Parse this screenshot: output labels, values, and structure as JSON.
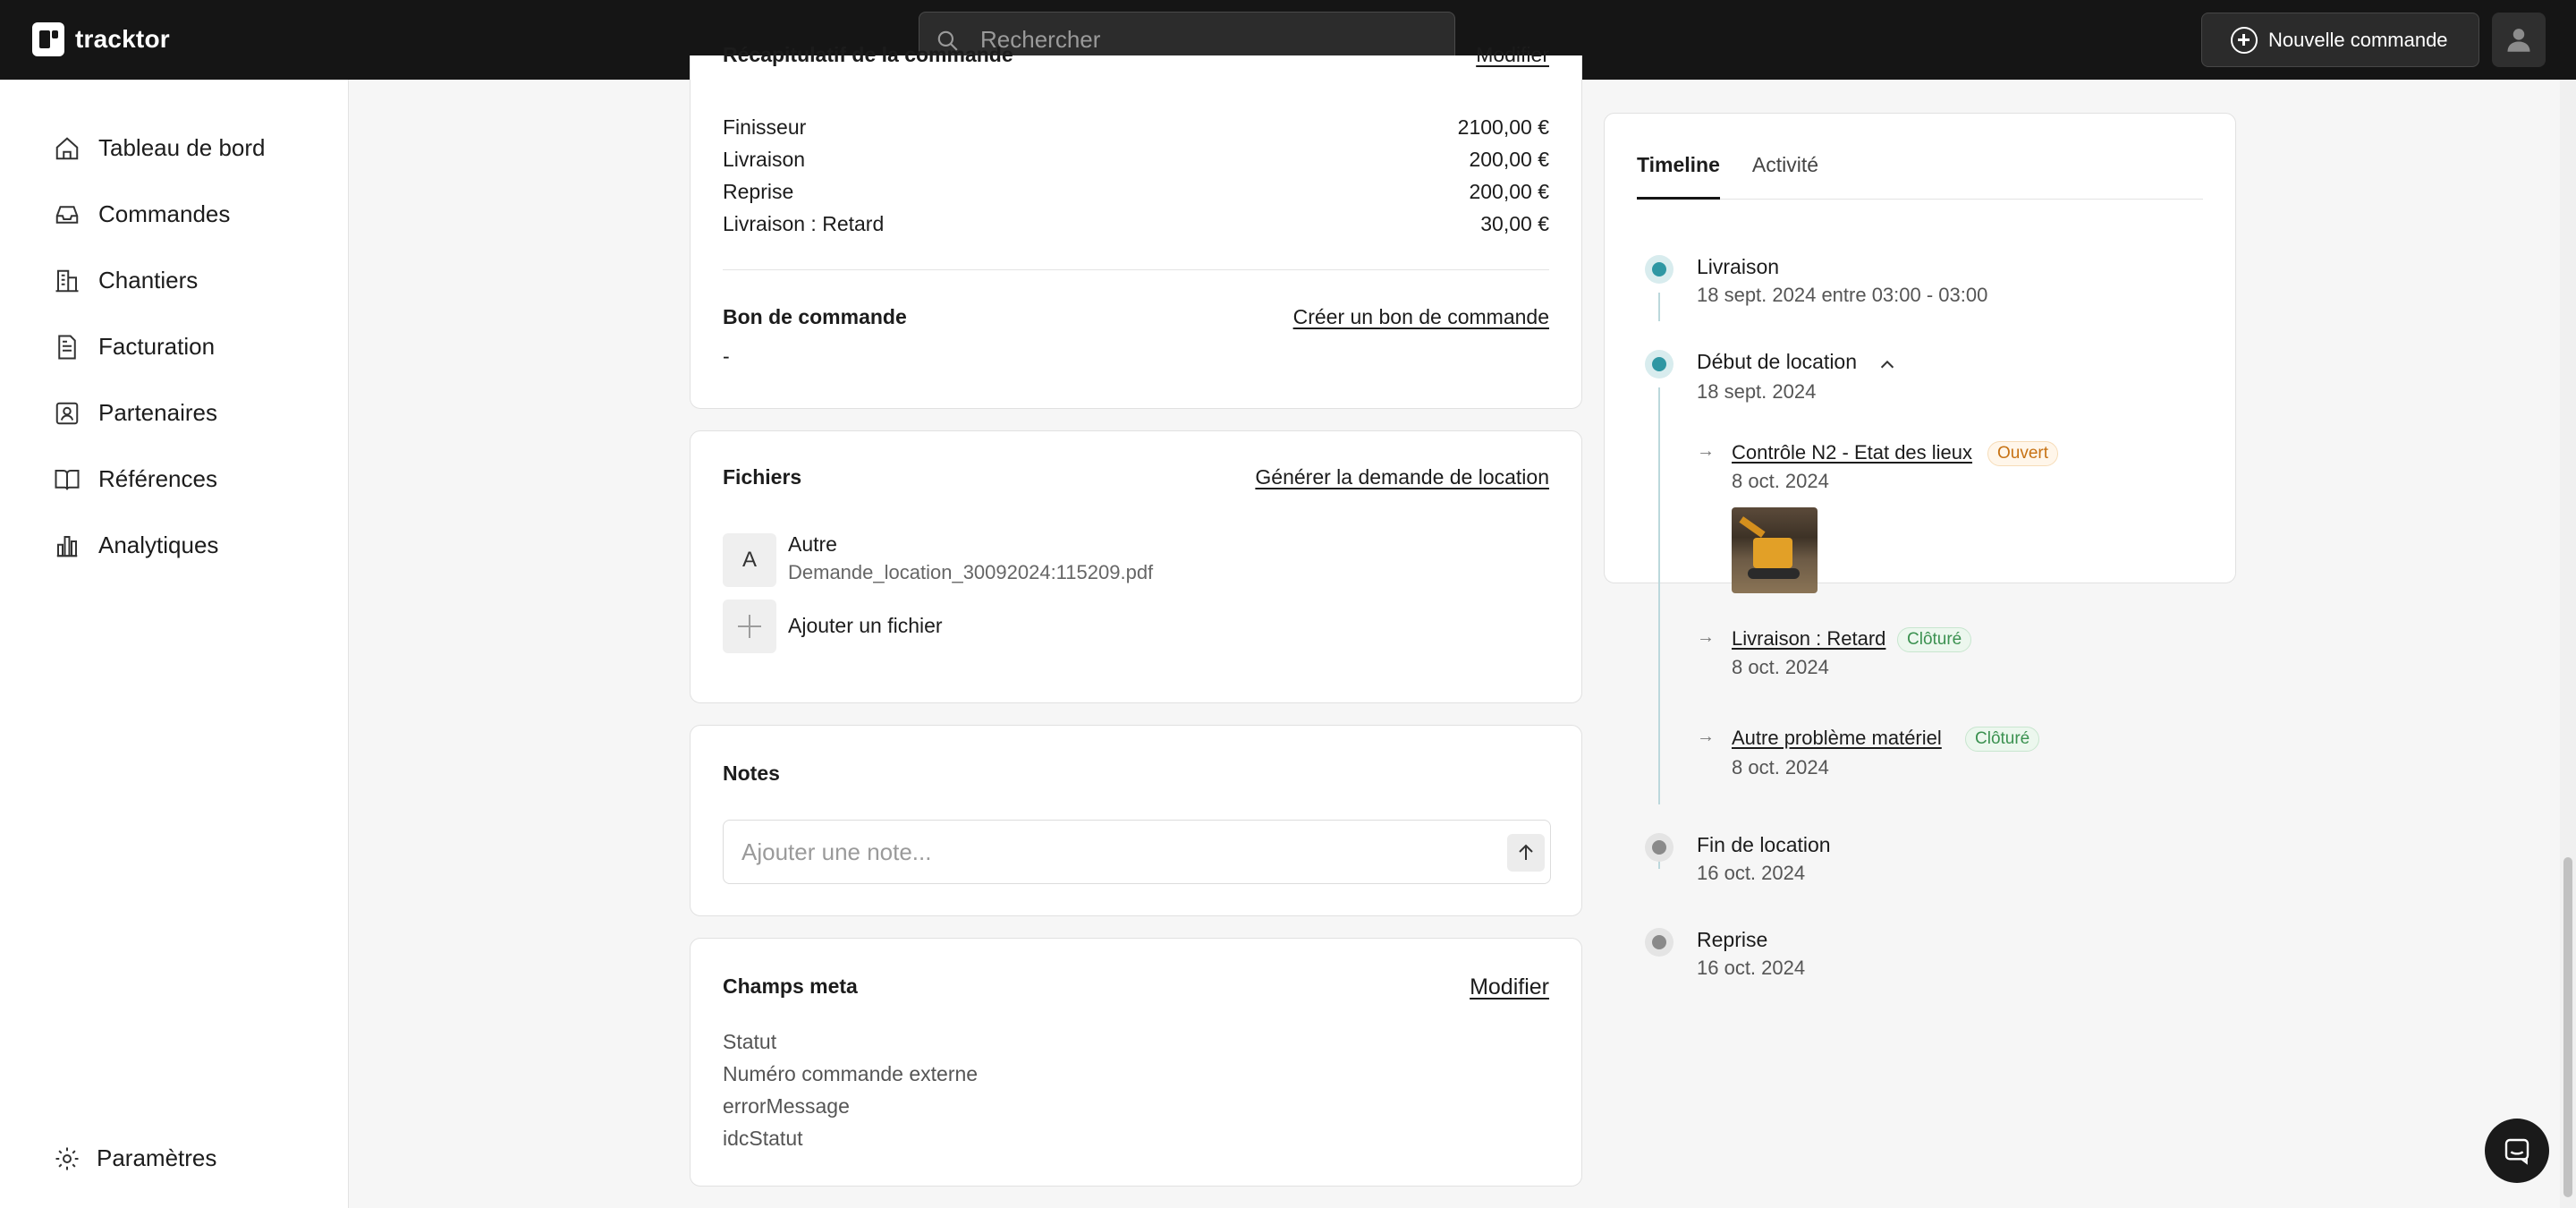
{
  "app": {
    "name": "tracktor"
  },
  "search": {
    "placeholder": "Rechercher"
  },
  "header": {
    "new_order_label": "Nouvelle commande"
  },
  "sidebar": {
    "items": [
      {
        "label": "Tableau de bord",
        "icon": "home-icon"
      },
      {
        "label": "Commandes",
        "icon": "inbox-icon"
      },
      {
        "label": "Chantiers",
        "icon": "building-icon"
      },
      {
        "label": "Facturation",
        "icon": "file-icon"
      },
      {
        "label": "Partenaires",
        "icon": "contact-icon"
      },
      {
        "label": "Références",
        "icon": "book-icon"
      },
      {
        "label": "Analytiques",
        "icon": "chart-icon"
      }
    ],
    "settings_label": "Paramètres"
  },
  "recap": {
    "title": "Récapitulatif de la commande",
    "edit_label": "Modifier",
    "lines": [
      {
        "label": "Finisseur",
        "amount": "2100,00 €"
      },
      {
        "label": "Livraison",
        "amount": "200,00 €"
      },
      {
        "label": "Reprise",
        "amount": "200,00 €"
      },
      {
        "label": "Livraison : Retard",
        "amount": "30,00 €"
      }
    ],
    "po_title": "Bon de commande",
    "po_action": "Créer un bon de commande",
    "po_value": "-"
  },
  "files": {
    "title": "Fichiers",
    "action": "Générer la demande de location",
    "items": [
      {
        "initial": "A",
        "type": "Autre",
        "name": "Demande_location_30092024:115209.pdf"
      }
    ],
    "add_label": "Ajouter un fichier"
  },
  "notes": {
    "title": "Notes",
    "placeholder": "Ajouter une note..."
  },
  "meta": {
    "title": "Champs meta",
    "edit_label": "Modifier",
    "fields": [
      "Statut",
      "Numéro commande externe",
      "errorMessage",
      "idcStatut"
    ]
  },
  "timeline": {
    "tabs": [
      "Timeline",
      "Activité"
    ],
    "events": [
      {
        "title": "Livraison",
        "date": "18 sept. 2024 entre 03:00 - 03:00"
      },
      {
        "title": "Début de location",
        "date": "18 sept. 2024"
      },
      {
        "title": "Fin de location",
        "date": "16 oct. 2024"
      },
      {
        "title": "Reprise",
        "date": "16 oct. 2024"
      }
    ],
    "sub_events": [
      {
        "title": "Contrôle N2 - Etat des lieux",
        "badge": "Ouvert",
        "date": "8 oct. 2024"
      },
      {
        "title": "Livraison : Retard",
        "badge": "Clôturé",
        "date": "8 oct. 2024"
      },
      {
        "title": "Autre problème matériel",
        "badge": "Clôturé",
        "date": "8 oct. 2024"
      }
    ]
  },
  "colors": {
    "accent": "#2f97a3",
    "open": "#c77214",
    "closed": "#3b9150",
    "topbar": "#151515"
  }
}
